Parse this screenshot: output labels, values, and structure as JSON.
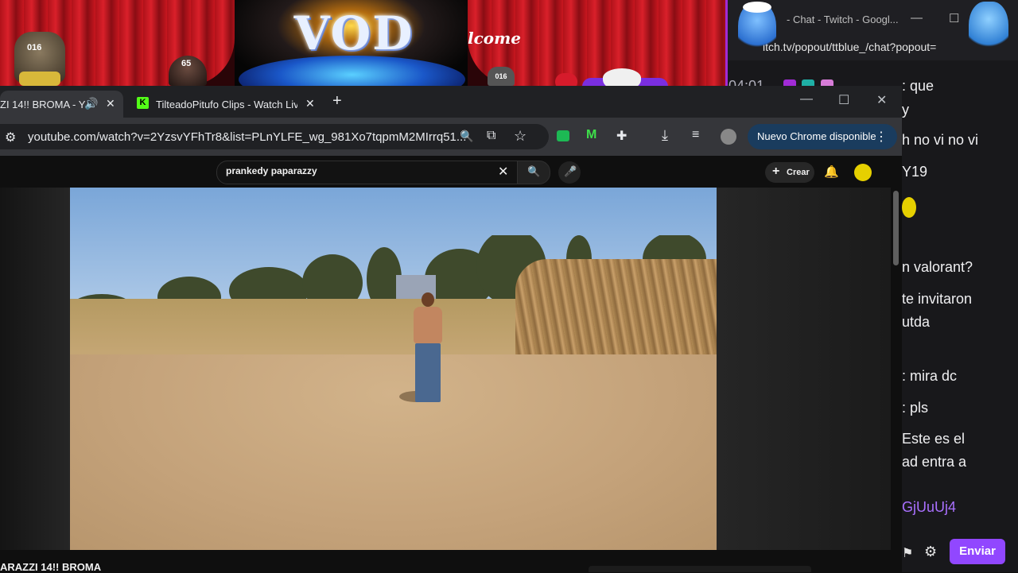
{
  "overlay": {
    "banner_text": "VOD",
    "welcome_text": "lcome",
    "cat_badge": "016",
    "man_badge": "65",
    "small_badge": "016"
  },
  "chat_window": {
    "title": "- Chat - Twitch - Googl...",
    "url": "itch.tv/popout/ttblue_/chat?popout=",
    "lines": [
      {
        "text": "04:01",
        "top": 0
      },
      {
        "text": ": que",
        "top": 0
      },
      {
        "text": "y",
        "top": 0
      },
      {
        "text": "h no vi no vi",
        "top": 0
      },
      {
        "text": "Y19",
        "top": 0
      },
      {
        "text": "n valorant?",
        "top": 0
      },
      {
        "text": "te invitaron",
        "top": 0
      },
      {
        "text": "utda",
        "top": 0
      },
      {
        "text": ": mira dc",
        "top": 0
      },
      {
        "text": ": pls",
        "top": 0
      },
      {
        "text": "Este es el",
        "top": 0
      },
      {
        "text": "ad entra a",
        "top": 0
      },
      {
        "text": "GjUuUj4",
        "top": 0
      }
    ],
    "send_label": "Enviar",
    "accent": "#9147ff"
  },
  "browser": {
    "tabs": [
      {
        "title": "ZI 14!! BROMA - Y",
        "active": true
      },
      {
        "title": "TilteadoPitufo Clips - Watch Liv",
        "active": false
      }
    ],
    "new_tab": "+",
    "url": "youtube.com/watch?v=2YzsvYFhTr8&list=PLnYLFE_wg_981Xo7tqpmM2MIrrq51...",
    "update_label": "Nuevo Chrome disponible",
    "update_menu": "⋮"
  },
  "youtube": {
    "search_query": "prankedy paparazzy",
    "create_label": "Crear",
    "video_title": "ARAZZI 14!! BROMA"
  },
  "icons": {
    "search": "🔍",
    "mic": "🎤",
    "bell": "🔔",
    "close": "✕",
    "star": "☆",
    "download": "⤓",
    "gear": "⚙"
  }
}
